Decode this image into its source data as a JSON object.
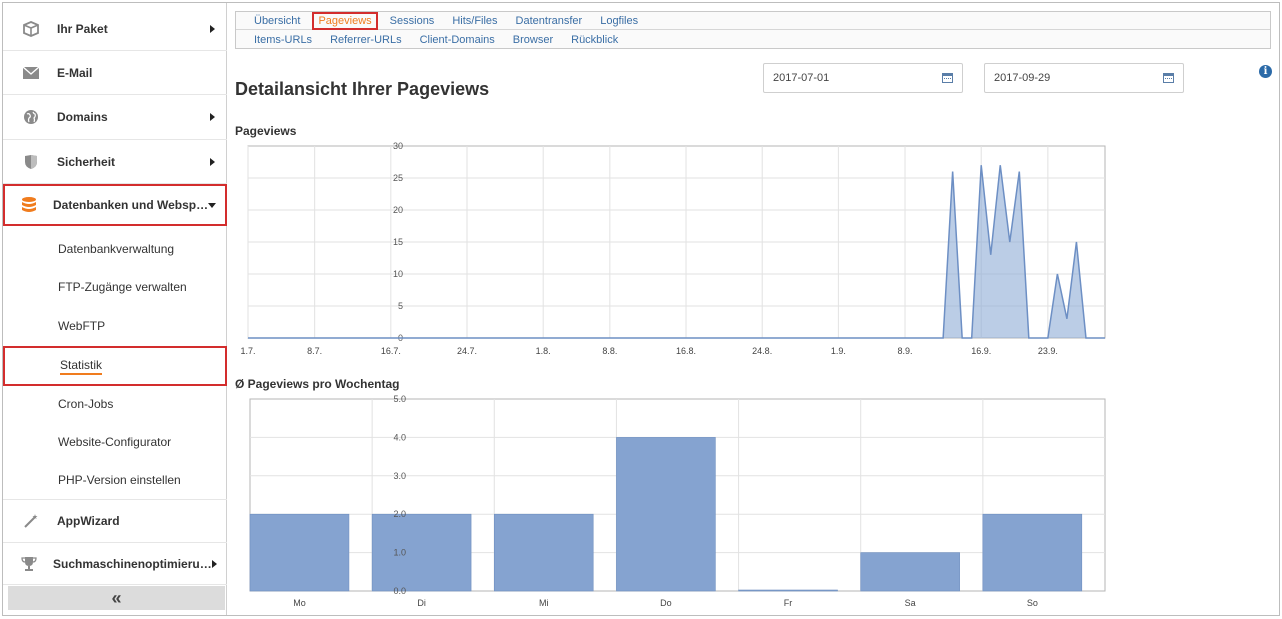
{
  "sidebar": {
    "items": [
      {
        "label": "Ihr Paket",
        "icon": "package-icon"
      },
      {
        "label": "E-Mail",
        "icon": "mail-icon"
      },
      {
        "label": "Domains",
        "icon": "globe-icon"
      },
      {
        "label": "Sicherheit",
        "icon": "shield-icon"
      },
      {
        "label": "Datenbanken und Websp…",
        "icon": "database-icon"
      }
    ],
    "subitems": [
      "Datenbankverwaltung",
      "FTP-Zugänge verwalten",
      "WebFTP",
      "Statistik",
      "Cron-Jobs",
      "Website-Configurator",
      "PHP-Version einstellen"
    ],
    "bottom_items": [
      {
        "label": "AppWizard",
        "icon": "magic-wand-icon"
      },
      {
        "label": "Suchmaschinenoptimieru…",
        "icon": "trophy-icon"
      }
    ],
    "collapse_label": "«",
    "active_subitem": "Statistik",
    "colors": {
      "accent": "#f07c1e",
      "highlight": "#d32d2d"
    }
  },
  "tabs": {
    "row1": [
      "Übersicht",
      "Pageviews",
      "Sessions",
      "Hits/Files",
      "Datentransfer",
      "Logfiles"
    ],
    "row2": [
      "Items-URLs",
      "Referrer-URLs",
      "Client-Domains",
      "Browser",
      "Rückblick"
    ],
    "active": "Pageviews"
  },
  "page": {
    "title": "Detailansicht Ihrer Pageviews",
    "date_from": "2017-07-01",
    "date_to": "2017-09-29",
    "info_icon": "i",
    "chart1_title": "Pageviews",
    "chart2_title": "Ø Pageviews pro Wochentag"
  },
  "chart_data": [
    {
      "type": "area",
      "title": "Pageviews",
      "ylim": [
        0,
        30
      ],
      "yticks": [
        0,
        5,
        10,
        15,
        20,
        25,
        30
      ],
      "x_tick_labels": [
        "1.7.",
        "8.7.",
        "16.7.",
        "24.7.",
        "1.8.",
        "8.8.",
        "16.8.",
        "24.8.",
        "1.9.",
        "8.9.",
        "16.9.",
        "23.9."
      ],
      "x_tick_days": [
        0,
        7,
        15,
        23,
        31,
        38,
        46,
        54,
        62,
        69,
        77,
        84
      ],
      "series": [
        {
          "values": [
            [
              0,
              0
            ],
            [
              73,
              0
            ],
            [
              74,
              26
            ],
            [
              75,
              0
            ],
            [
              76,
              0
            ],
            [
              77,
              27
            ],
            [
              78,
              13
            ],
            [
              79,
              27
            ],
            [
              80,
              15
            ],
            [
              81,
              26
            ],
            [
              82,
              0
            ],
            [
              83,
              0
            ],
            [
              84,
              0
            ],
            [
              85,
              10
            ],
            [
              86,
              3
            ],
            [
              87,
              15
            ],
            [
              88,
              0
            ],
            [
              89,
              0
            ],
            [
              90,
              0
            ]
          ]
        }
      ],
      "color": "#8eabd6",
      "line_color": "#6d8fc4"
    },
    {
      "type": "bar",
      "title": "Ø Pageviews pro Wochentag",
      "categories": [
        "Mo",
        "Di",
        "Mi",
        "Do",
        "Fr",
        "Sa",
        "So"
      ],
      "values": [
        2.0,
        2.0,
        2.0,
        4.0,
        0.0,
        1.0,
        2.0
      ],
      "ylim": [
        0,
        5
      ],
      "yticks": [
        "0.0",
        "1.0",
        "2.0",
        "3.0",
        "4.0",
        "5.0"
      ],
      "color": "#85a3d0"
    }
  ]
}
